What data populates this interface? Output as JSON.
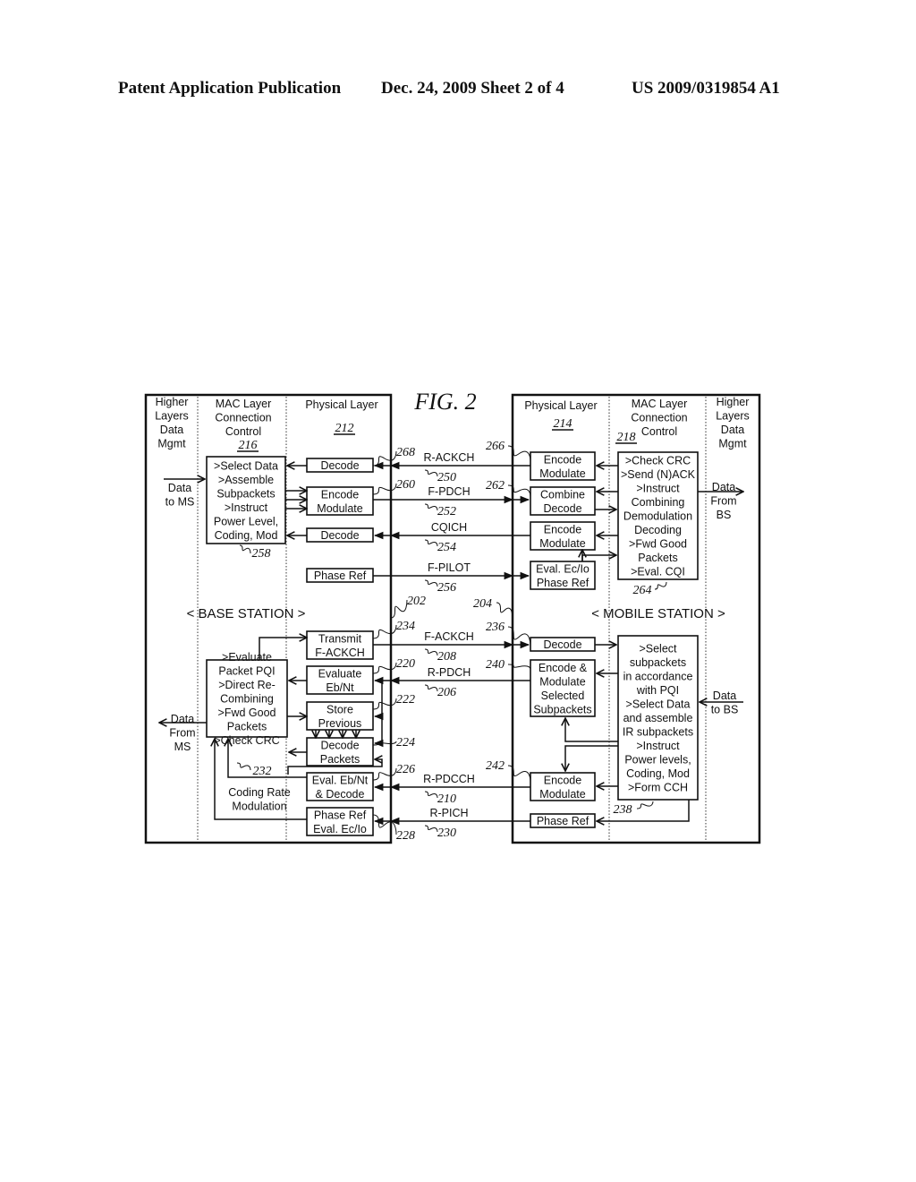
{
  "header": {
    "left": "Patent Application Publication",
    "date_sheet": "Dec. 24, 2009   Sheet 2 of 4",
    "number": "US 2009/0319854 A1"
  },
  "figure": {
    "title": "FIG.  2",
    "base_station": {
      "label": "<  BASE STATION  >",
      "ref": "202",
      "columns": {
        "higher": [
          "Higher",
          "Layers",
          "Data",
          "Mgmt"
        ],
        "mac": [
          "MAC Layer",
          "Connection",
          "Control"
        ],
        "mac_ref": "216",
        "phy": "Physical Layer",
        "phy_ref": "212"
      },
      "data_to_ms": [
        "Data",
        "to MS"
      ],
      "data_from_ms": [
        "Data",
        "From",
        "MS"
      ],
      "mac_box_top": {
        "lines": [
          ">Select Data",
          ">Assemble",
          "Subpackets",
          ">Instruct",
          "Power Level,",
          "Coding, Mod"
        ],
        "ref": "258"
      },
      "mac_box_bottom": {
        "lines": [
          ">Evaluate",
          "Packet PQI",
          ">Direct Re-",
          "Combining",
          ">Fwd Good",
          "Packets",
          ">Check CRC"
        ],
        "ref": "232"
      },
      "coding_rate_label": [
        "Coding Rate",
        "Modulation"
      ],
      "phy_boxes": [
        {
          "lines": [
            "Decode"
          ],
          "ref": "268"
        },
        {
          "lines": [
            "Encode",
            "Modulate"
          ],
          "ref": "260"
        },
        {
          "lines": [
            "Decode"
          ],
          "ref": ""
        },
        {
          "lines": [
            "Phase Ref"
          ],
          "ref": ""
        },
        {
          "lines": [
            "Transmit",
            "F-ACKCH"
          ],
          "ref": "234"
        },
        {
          "lines": [
            "Evaluate",
            "Eb/Nt"
          ],
          "ref": "220"
        },
        {
          "lines": [
            "Store",
            "Previous"
          ],
          "ref": "222"
        },
        {
          "lines": [
            "Decode",
            "Packets"
          ],
          "ref": "224"
        },
        {
          "lines": [
            "Eval. Eb/Nt",
            "& Decode"
          ],
          "ref": "226"
        },
        {
          "lines": [
            "Phase Ref",
            "Eval. Ec/Io"
          ],
          "ref": "228"
        }
      ]
    },
    "mobile_station": {
      "label": "<  MOBILE STATION  >",
      "ref": "204",
      "columns": {
        "phy": "Physical Layer",
        "phy_ref": "214",
        "mac": [
          "MAC Layer",
          "Connection",
          "Control"
        ],
        "mac_ref": "218",
        "higher": [
          "Higher",
          "Layers",
          "Data",
          "Mgmt"
        ]
      },
      "data_from_bs": [
        "Data",
        "From",
        "BS"
      ],
      "data_to_bs": [
        "Data",
        "to BS"
      ],
      "mac_box_top": {
        "lines": [
          ">Check CRC",
          ">Send (N)ACK",
          ">Instruct",
          "Combining",
          "Demodulation",
          "Decoding",
          ">Fwd Good",
          "Packets",
          ">Eval. CQI"
        ],
        "ref": "264"
      },
      "mac_box_bottom": {
        "lines": [
          ">Select",
          "subpackets",
          "in accordance",
          "with PQI",
          ">Select Data",
          "and assemble",
          "IR subpackets",
          ">Instruct",
          "Power levels,",
          "Coding, Mod",
          ">Form CCH"
        ],
        "ref": "238"
      },
      "phy_boxes": [
        {
          "lines": [
            "Encode",
            "Modulate"
          ],
          "ref": "266"
        },
        {
          "lines": [
            "Combine",
            "Decode"
          ],
          "ref": "262"
        },
        {
          "lines": [
            "Encode",
            "Modulate"
          ],
          "ref": ""
        },
        {
          "lines": [
            "Eval. Ec/Io",
            "Phase Ref"
          ],
          "ref": ""
        },
        {
          "lines": [
            "Decode"
          ],
          "ref": "236"
        },
        {
          "lines": [
            "Encode &",
            "Modulate",
            "Selected",
            "Subpackets"
          ],
          "ref": "240"
        },
        {
          "lines": [
            "Encode",
            "Modulate"
          ],
          "ref": "242"
        },
        {
          "lines": [
            "Phase Ref"
          ],
          "ref": ""
        }
      ]
    },
    "channels": [
      {
        "name": "R-ACKCH",
        "ref": "250",
        "direction": "to-base"
      },
      {
        "name": "F-PDCH",
        "ref": "252",
        "direction": "to-mobile"
      },
      {
        "name": "CQICH",
        "ref": "254",
        "direction": "to-base"
      },
      {
        "name": "F-PILOT",
        "ref": "256",
        "direction": "to-mobile"
      },
      {
        "name": "F-ACKCH",
        "ref": "208",
        "direction": "to-mobile"
      },
      {
        "name": "R-PDCH",
        "ref": "206",
        "direction": "to-base"
      },
      {
        "name": "R-PDCCH",
        "ref": "210",
        "direction": "to-base"
      },
      {
        "name": "R-PICH",
        "ref": "230",
        "direction": "to-base"
      }
    ]
  }
}
